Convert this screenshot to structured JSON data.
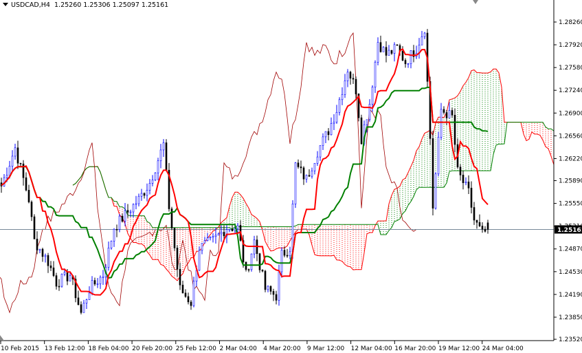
{
  "header": {
    "symbol": "USDCAD,H4",
    "open": "1.25260",
    "high": "1.25306",
    "low": "1.25097",
    "close": "1.25161"
  },
  "current_price_label": "1.25161",
  "chart_data": {
    "type": "candlestick",
    "title": "USDCAD,H4",
    "indicator": "Ichimoku Kinko Hyo (9,26,52)",
    "ylim": [
      1.2352,
      1.2855
    ],
    "y_ticks": [
      "1.28260",
      "1.27920",
      "1.27580",
      "1.27240",
      "1.26900",
      "1.26560",
      "1.26220",
      "1.25890",
      "1.25550",
      "1.25210",
      "1.24870",
      "1.24530",
      "1.24190",
      "1.23850",
      "1.23520"
    ],
    "x_ticks": [
      "10 Feb 2015",
      "13 Feb 12:00",
      "18 Feb 04:00",
      "20 Feb 20:00",
      "25 Feb 12:00",
      "2 Mar 04:00",
      "4 Mar 20:00",
      "9 Mar 12:00",
      "12 Mar 04:00",
      "16 Mar 20:00",
      "19 Mar 12:00",
      "24 Mar 04:00"
    ],
    "bar_count": 178,
    "close_path": [
      [
        0,
        1.2581
      ],
      [
        5,
        1.2638
      ],
      [
        10,
        1.2561
      ],
      [
        12,
        1.2499
      ],
      [
        17,
        1.2468
      ],
      [
        20,
        1.2437
      ],
      [
        25,
        1.2448
      ],
      [
        29,
        1.2391
      ],
      [
        32,
        1.2427
      ],
      [
        37,
        1.2448
      ],
      [
        41,
        1.2519
      ],
      [
        50,
        1.2561
      ],
      [
        54,
        1.2586
      ],
      [
        59,
        1.2643
      ],
      [
        61,
        1.255
      ],
      [
        65,
        1.2427
      ],
      [
        69,
        1.2407
      ],
      [
        72,
        1.2489
      ],
      [
        77,
        1.2499
      ],
      [
        82,
        1.2519
      ],
      [
        86,
        1.2519
      ],
      [
        89,
        1.2448
      ],
      [
        92,
        1.2499
      ],
      [
        96,
        1.2427
      ],
      [
        100,
        1.2417
      ],
      [
        102,
        1.2478
      ],
      [
        105,
        1.2489
      ],
      [
        107,
        1.2612
      ],
      [
        111,
        1.2591
      ],
      [
        115,
        1.2633
      ],
      [
        119,
        1.2664
      ],
      [
        122,
        1.2695
      ],
      [
        126,
        1.2756
      ],
      [
        129,
        1.2725
      ],
      [
        131,
        1.2653
      ],
      [
        134,
        1.2705
      ],
      [
        137,
        1.2797
      ],
      [
        140,
        1.2777
      ],
      [
        144,
        1.2787
      ],
      [
        147,
        1.2766
      ],
      [
        151,
        1.2787
      ],
      [
        154,
        1.2818
      ],
      [
        156,
        1.2653
      ],
      [
        157,
        1.255
      ],
      [
        160,
        1.2695
      ],
      [
        164,
        1.2684
      ],
      [
        166,
        1.2602
      ],
      [
        170,
        1.2571
      ],
      [
        172,
        1.253
      ],
      [
        175,
        1.2509
      ],
      [
        177,
        1.2516
      ]
    ]
  }
}
